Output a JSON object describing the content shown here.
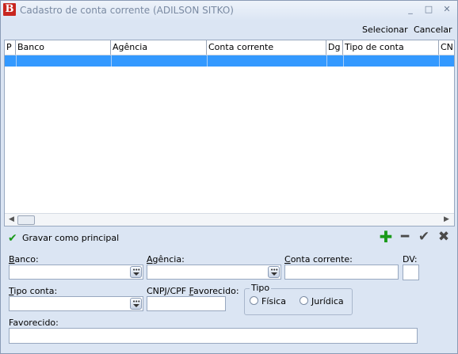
{
  "window": {
    "title": "Cadastro de conta corrente (ADILSON SITKO)",
    "logo_letter": "B",
    "controls": {
      "minimize": "_",
      "maximize": "□",
      "close": "✕"
    }
  },
  "toolbar": {
    "select_label": "Selecionar",
    "cancel_label": "Cancelar"
  },
  "grid": {
    "columns": [
      "P",
      "Banco",
      "Agência",
      "Conta corrente",
      "Dg",
      "Tipo de conta",
      "CN"
    ],
    "scroll_left": "◀",
    "scroll_right": "▶"
  },
  "actions": {
    "save_main_label": "Gravar como principal",
    "save_main_icon": "check-icon",
    "add_icon": "plus-icon",
    "remove_icon": "minus-icon",
    "confirm_icon": "check-icon",
    "delete_icon": "close-icon"
  },
  "form": {
    "banco_label_u": "B",
    "banco_label_rest": "anco:",
    "banco_value": "",
    "agencia_label_u": "A",
    "agencia_label_rest": "gência:",
    "agencia_value": "",
    "conta_label_u": "C",
    "conta_label_rest": "onta corrente:",
    "conta_value": "",
    "dv_label": "DV:",
    "dv_value": "",
    "tipo_conta_label_u": "T",
    "tipo_conta_label_rest": "ipo conta:",
    "tipo_conta_value": "",
    "cnpj_label_pre": "CNPJ/CPF ",
    "cnpj_label_u": "F",
    "cnpj_label_rest": "avorecido:",
    "cnpj_value": "",
    "tipo_group_label": "Tipo",
    "tipo_options": [
      "Física",
      "Jurídica"
    ],
    "favorecido_label": "Favorecido:",
    "favorecido_value": ""
  },
  "colors": {
    "selection": "#3399ff",
    "background": "#dbe5f3",
    "logo": "#c8261f",
    "green_icon": "#1a9a1a"
  }
}
